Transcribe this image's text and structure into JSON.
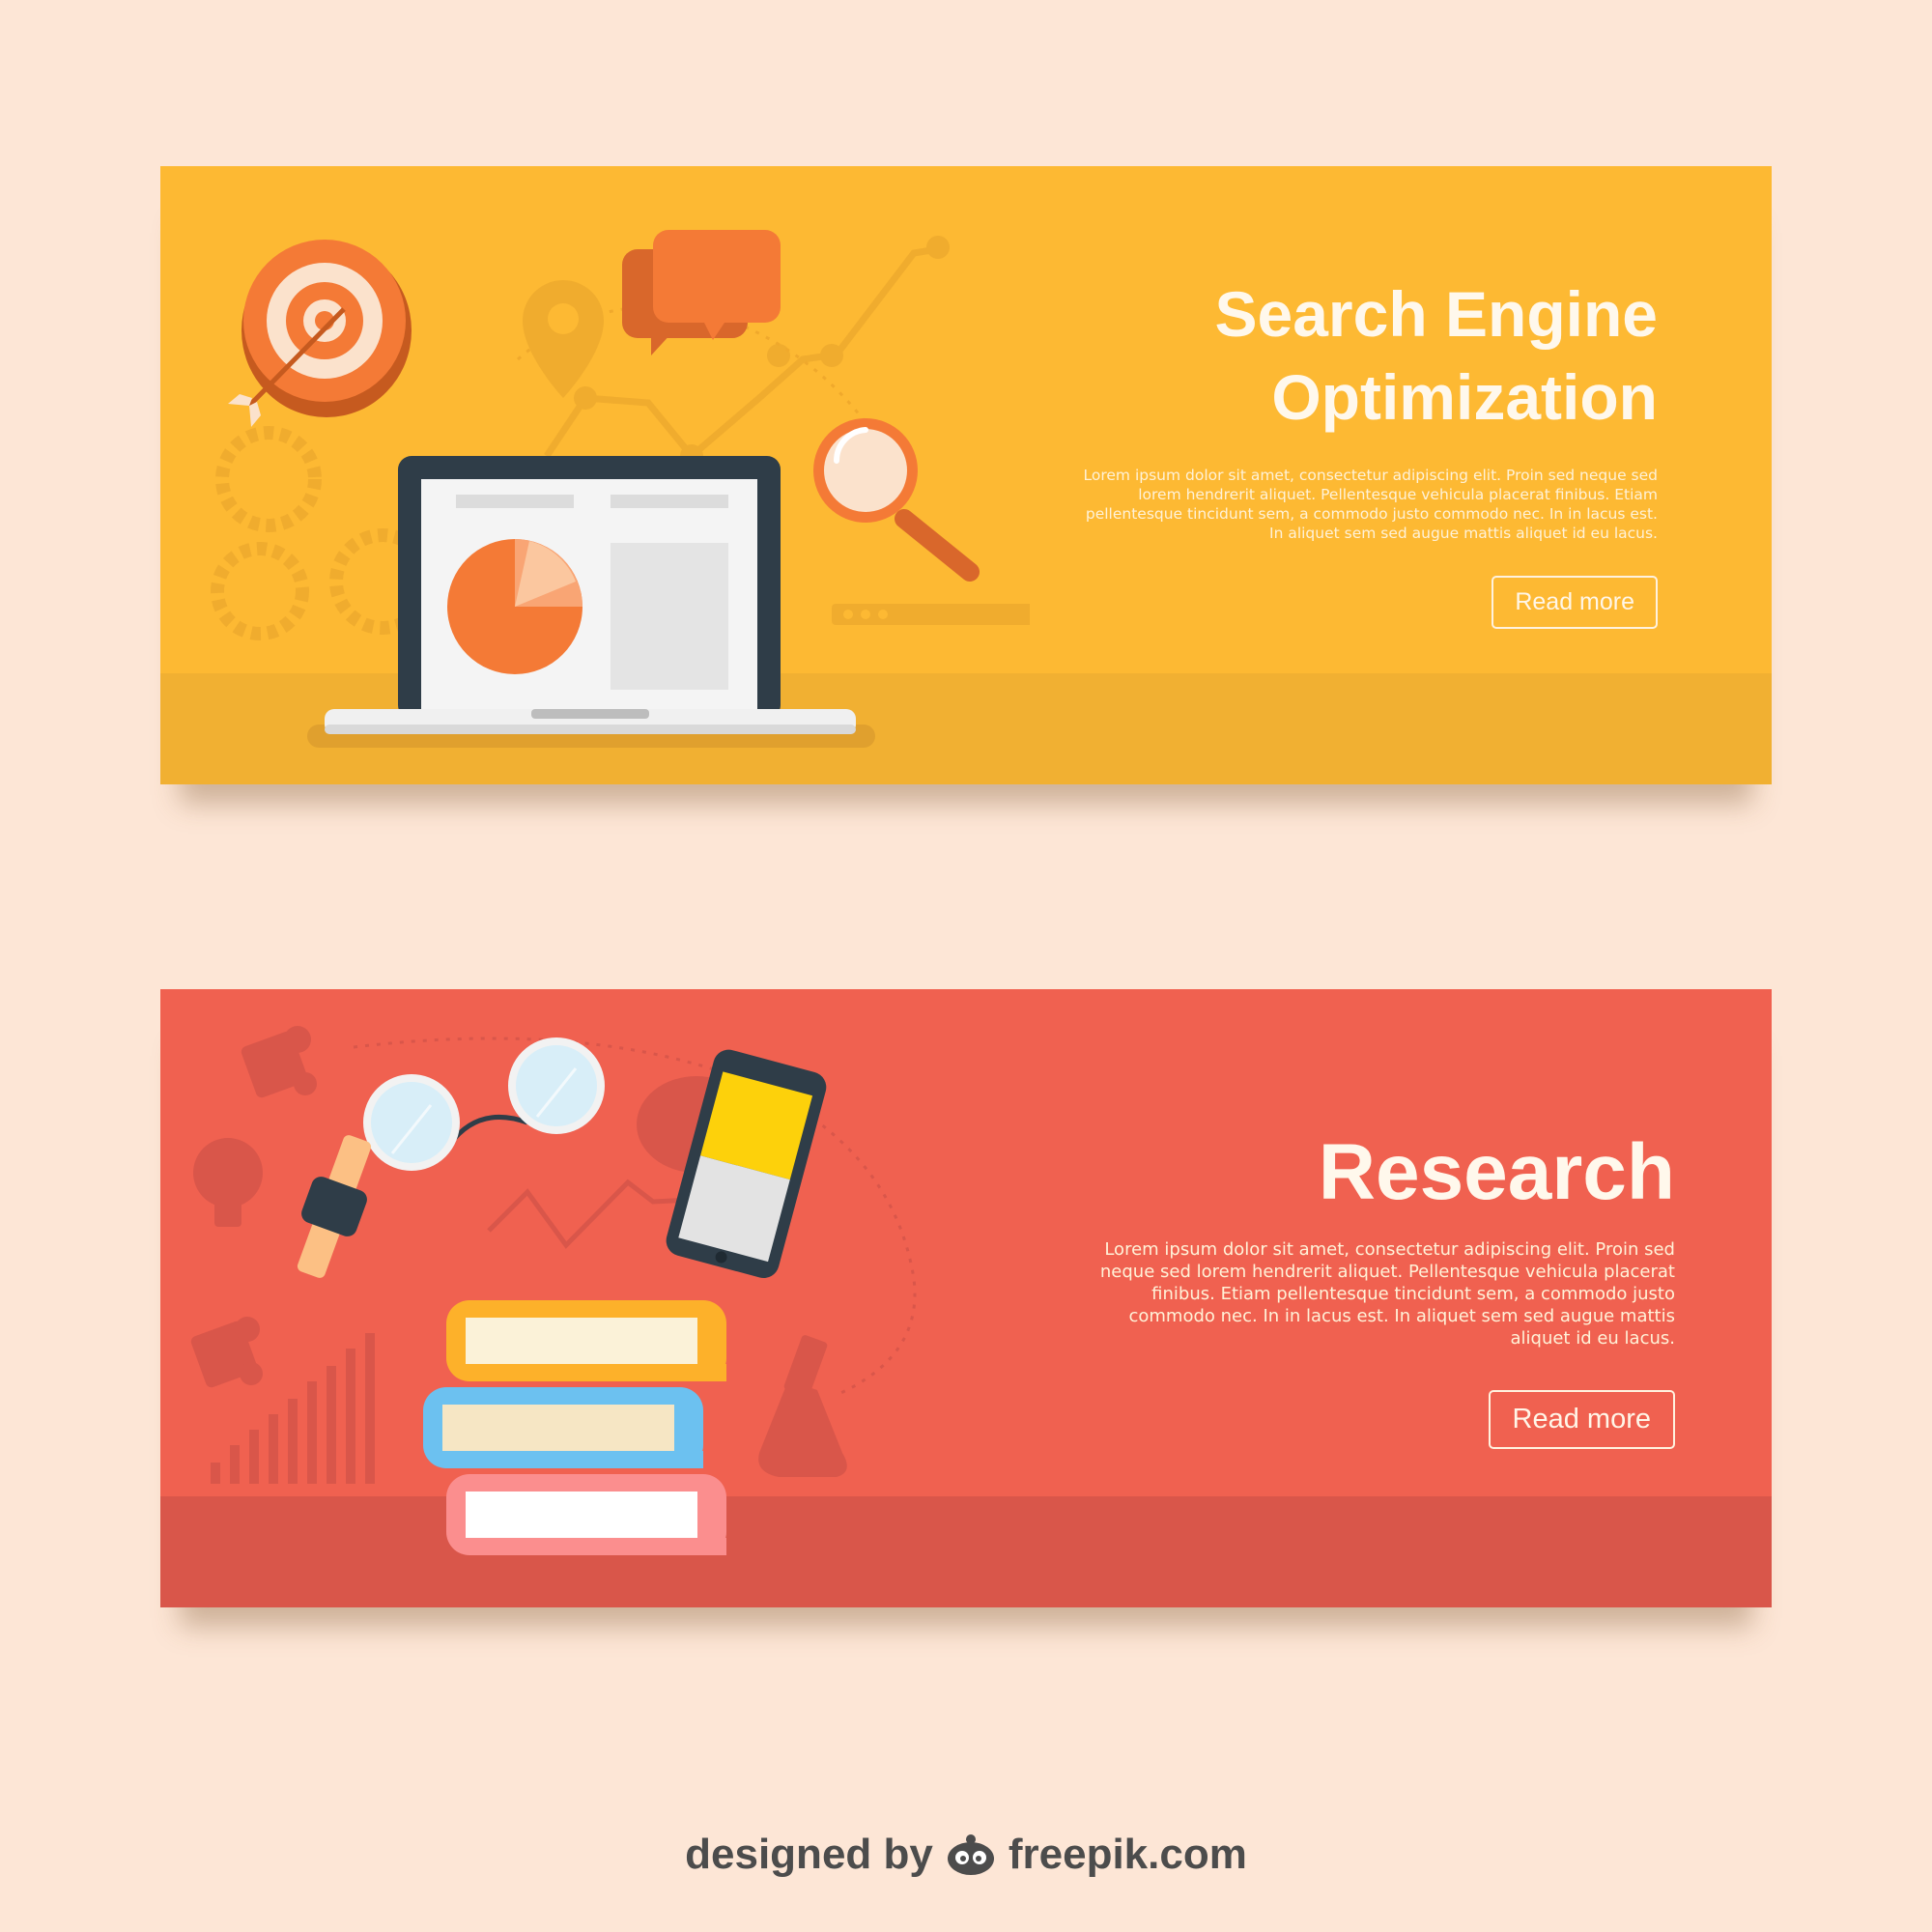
{
  "colors": {
    "page_background": "#fde6d6",
    "seo_banner": "#fdb933",
    "research_banner": "#f06150",
    "accent_orange": "#f47a36",
    "footer_text": "#4c4c4c"
  },
  "seo_banner": {
    "title_line1": "Search Engine",
    "title_line2": "Optimization",
    "body": "Lorem ipsum dolor sit amet, consectetur adipiscing elit. Proin sed neque sed lorem hendrerit aliquet. Pellentesque vehicula placerat finibus. Etiam pellentesque tincidunt sem, a commodo justo commodo nec. In in lacus est. In aliquet sem sed augue mattis aliquet id eu lacus.",
    "button_label": "Read more",
    "icons": [
      "target-icon",
      "arrow-icon",
      "map-pin-icon",
      "chat-bubble-icon",
      "line-graph-icon",
      "gear-icon",
      "laptop-icon",
      "pie-chart-icon",
      "magnifying-glass-icon",
      "search-bar-icon"
    ]
  },
  "research_banner": {
    "title": "Research",
    "body": "Lorem ipsum dolor sit amet, consectetur adipiscing elit. Proin sed neque sed lorem hendrerit aliquet. Pellentesque vehicula placerat finibus. Etiam pellentesque tincidunt sem, a commodo justo commodo nec. In in lacus est. In aliquet sem sed augue mattis aliquet id eu lacus.",
    "button_label": "Read more",
    "icons": [
      "puzzle-piece-icon",
      "glasses-icon",
      "chat-bubble-icon",
      "smartphone-icon",
      "lightbulb-icon",
      "wristwatch-icon",
      "line-graph-icon",
      "bar-chart-icon",
      "books-icon",
      "flask-icon"
    ]
  },
  "footer": {
    "prefix": "designed by",
    "brand": "freepik.com",
    "logo_icon": "freepik-logo-icon"
  }
}
